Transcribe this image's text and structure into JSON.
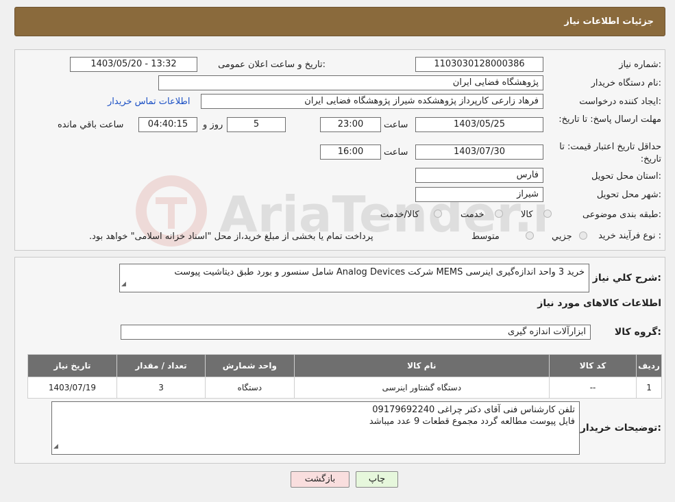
{
  "header": {
    "title": "جزئیات اطلاعات نیاز"
  },
  "form": {
    "need_number_label": "شماره نیاز:",
    "need_number": "1103030128000386",
    "announce_label": "تاریخ و ساعت اعلان عمومی:",
    "announce_value": "1403/05/20 - 13:32",
    "buyer_label": "نام دستگاه خریدار:",
    "buyer_value": "پژوهشگاه فضایی ایران",
    "creator_label": "ایجاد کننده درخواست:",
    "creator_value": "فرهاد زارعی کارپرداز پژوهشکده شیراز پژوهشگاه فضایی ایران",
    "contact_link": "اطلاعات تماس خریدار",
    "deadline_label": "مهلت ارسال پاسخ: تا تاریخ:",
    "deadline_date": "1403/05/25",
    "time_label": "ساعت",
    "deadline_time": "23:00",
    "days_value": "5",
    "days_label": "روز و",
    "remaining_value": "04:40:15",
    "remaining_label": "ساعت باقي مانده",
    "validity_label": "حداقل تاریخ اعتبار قیمت: تا تاریخ:",
    "validity_date": "1403/07/30",
    "validity_time": "16:00",
    "province_label": "استان محل تحویل:",
    "province_value": "فارس",
    "city_label": "شهر محل تحویل:",
    "city_value": "شیراز",
    "category_label": "طبقه بندی موضوعی:",
    "category_options": [
      "کالا",
      "خدمت",
      "کالا/خدمت"
    ],
    "process_label": "نوع فرآیند خرید :",
    "process_options": [
      "جزیي",
      "متوسط"
    ],
    "payment_note": "پرداخت تمام یا بخشی از مبلغ خرید،از محل \"اسناد خزانه اسلامی\" خواهد بود."
  },
  "summary": {
    "label": "شرح کلي نياز:",
    "value": "خرید 3  واحد اندازه‌گیری اینرسی MEMS شرکت Analog Devices شامل سنسور و بورد طبق دیتاشیت پیوست",
    "items_heading": "اطلاعات کالاهای مورد نياز",
    "group_label": "گروه کالا:",
    "group_value": "ابزارآلات اندازه گیری"
  },
  "table": {
    "headers": [
      "رديف",
      "کد کالا",
      "نام کالا",
      "واحد شمارش",
      "تعداد / مقدار",
      "تاریخ نیاز"
    ],
    "rows": [
      [
        "1",
        "--",
        "دستگاه گشتاور اینرسی",
        "دستگاه",
        "3",
        "1403/07/19"
      ]
    ]
  },
  "notes": {
    "label": "توضیحات خریدار:",
    "line1": "تلفن کارشناس فنی آقای دکتر چراغی 09179692240",
    "line2": "فایل پیوست مطالعه گردد مجموع قطعات 9 عدد میباشد"
  },
  "buttons": {
    "print": "چاپ",
    "back": "بازگشت"
  },
  "watermark": {
    "text": "AriaTender.neT"
  },
  "colors": {
    "header": "#8a6a3c",
    "table_header": "#6f6f6f",
    "back_button": "#f9dede",
    "print_button": "#e6f7dc"
  }
}
